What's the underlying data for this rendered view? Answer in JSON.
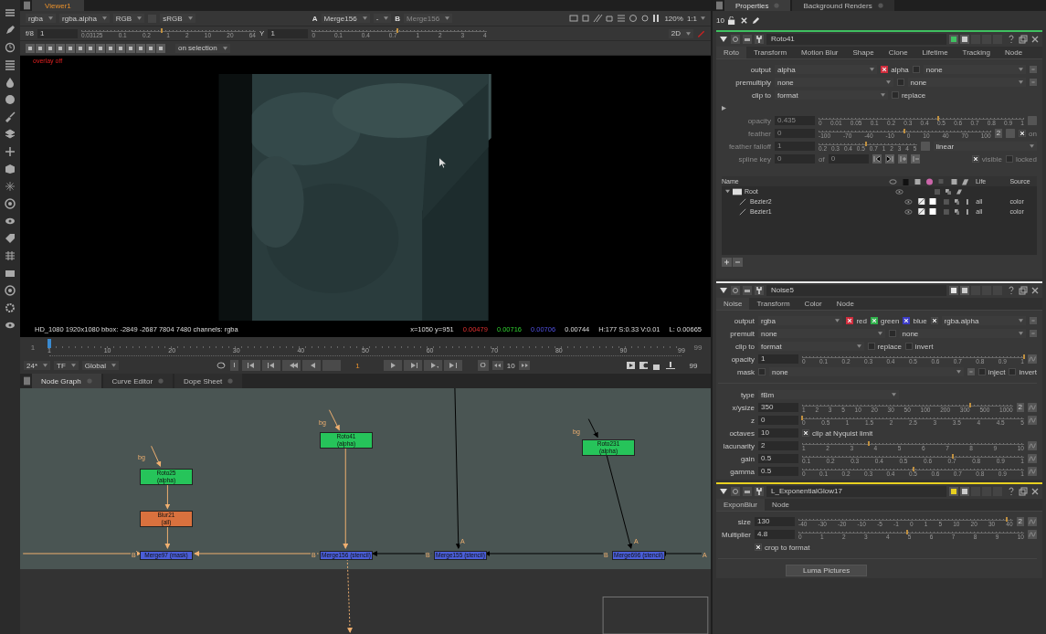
{
  "viewer": {
    "tab": "Viewer1",
    "toolbar": {
      "channels": "rgba",
      "layer": "rgba.alpha",
      "display": "RGB",
      "lut": "sRGB",
      "input_a_label": "A",
      "input_a": "Merge156",
      "operation": "-",
      "input_b_label": "B",
      "input_b": "Merge156",
      "zoom": "120%",
      "proxy": "1:1"
    },
    "gain": {
      "label": "f/8",
      "value": "1",
      "level": 0.46,
      "ticks": [
        "0.03125",
        "0.1",
        "0.2",
        "1",
        "2",
        "10",
        "20",
        "64"
      ]
    },
    "gamma": {
      "label": "Y",
      "value": "1",
      "level": 0.49,
      "ticks": [
        "0",
        "0.1",
        "0.4",
        "0.7",
        "1",
        "2",
        "3",
        "4"
      ]
    },
    "mode": "2D",
    "roi_menu": "on selection",
    "overlay_note": "overlay off",
    "info": {
      "format": "HD_1080 1920x1080  bbox: -2849 -2687 7804 7480 channels: rgba",
      "coords": "x=1050 y=951",
      "r": "0.00479",
      "g": "0.00716",
      "b": "0.00706",
      "a": "0.00744",
      "hsv": "H:177 S:0.33 V:0.01",
      "luma": "L: 0.00665"
    }
  },
  "timeline": {
    "in": "1",
    "out": "99",
    "level": 0,
    "ticks": [
      "1",
      "10",
      "20",
      "30",
      "40",
      "50",
      "60",
      "70",
      "80",
      "90",
      "99"
    ],
    "fps": "24*",
    "tf": "TF",
    "range": "Global",
    "in_mark": "I",
    "frame": "1",
    "out_mark": "O",
    "step": "10",
    "end": "99"
  },
  "node_graph": {
    "tabs": [
      {
        "label": "Node Graph",
        "selected": true
      },
      {
        "label": "Curve Editor",
        "selected": false
      },
      {
        "label": "Dope Sheet",
        "selected": false
      }
    ],
    "nodes": [
      {
        "kind": "roto",
        "name": "Roto25",
        "sub": "(alpha)"
      },
      {
        "kind": "blur",
        "name": "Blur21",
        "sub": "(all)"
      },
      {
        "kind": "merge",
        "name": "Merge97 (mask)"
      },
      {
        "kind": "roto",
        "name": "Roto41",
        "sub": "(alpha)"
      },
      {
        "kind": "merge",
        "name": "Merge156 (stencil)"
      },
      {
        "kind": "merge",
        "name": "Merge155 (stencil)"
      },
      {
        "kind": "roto",
        "name": "Roto231",
        "sub": "(alpha)"
      },
      {
        "kind": "merge",
        "name": "Merge696 (stencil)"
      }
    ],
    "pipe_labels": [
      "bg",
      "bg",
      "bg",
      "B",
      "B",
      "B",
      "B",
      "A",
      "A",
      "A"
    ]
  },
  "properties": {
    "tabs": [
      {
        "label": "Properties",
        "selected": true
      },
      {
        "label": "Background Renders",
        "selected": false
      }
    ],
    "max_panels": "10",
    "panels": [
      {
        "name": "Roto41",
        "color": "#3fc060",
        "tabs": [
          {
            "label": "Roto",
            "selected": true
          },
          {
            "label": "Transform",
            "selected": false
          },
          {
            "label": "Motion Blur",
            "selected": false
          },
          {
            "label": "Shape",
            "selected": false
          },
          {
            "label": "Clone",
            "selected": false
          },
          {
            "label": "Lifetime",
            "selected": false
          },
          {
            "label": "Tracking",
            "selected": false
          },
          {
            "label": "Node",
            "selected": false
          }
        ],
        "rows": [
          {
            "label": "output",
            "disabled": false,
            "widgets": [
              {
                "kind": "menu",
                "value": "alpha"
              },
              {
                "kind": "check",
                "label": "alpha",
                "checked": true,
                "color": "#d02c3c"
              },
              {
                "kind": "check",
                "checked": false
              },
              {
                "kind": "menu",
                "value": "none"
              },
              {
                "kind": "link"
              }
            ]
          },
          {
            "label": "premultiply",
            "disabled": false,
            "widgets": [
              {
                "kind": "menu",
                "value": "none"
              },
              {
                "kind": "check",
                "checked": false
              },
              {
                "kind": "menu",
                "value": "none"
              },
              {
                "kind": "link"
              }
            ]
          },
          {
            "label": "clip to",
            "disabled": false,
            "widgets": [
              {
                "kind": "menu",
                "value": "format"
              },
              {
                "kind": "check",
                "label": "replace",
                "checked": false
              },
              {
                "kind": "spacer"
              }
            ]
          },
          {
            "kind": "expander"
          },
          {
            "label": "opacity",
            "disabled": true,
            "widgets": [
              {
                "kind": "field",
                "value": "0.435"
              },
              {
                "kind": "slider",
                "level": 0.58,
                "ticks": [
                  "0",
                  "0.01",
                  "0.05",
                  "0.1",
                  "0.2",
                  "0.3",
                  "0.4",
                  "0.5",
                  "0.6",
                  "0.7",
                  "0.8",
                  "0.9",
                  "1"
                ]
              },
              {
                "kind": "square"
              }
            ]
          },
          {
            "label": "feather",
            "disabled": true,
            "widgets": [
              {
                "kind": "field",
                "value": "0"
              },
              {
                "kind": "slider",
                "level": 0.5,
                "ticks": [
                  "-100",
                  "-70",
                  "-40",
                  "-10",
                  "0",
                  "10",
                  "40",
                  "70",
                  "100"
                ]
              },
              {
                "kind": "button",
                "label": "2"
              },
              {
                "kind": "square"
              },
              {
                "kind": "check",
                "label": "on",
                "checked": true
              }
            ]
          },
          {
            "label": "feather falloff",
            "disabled": true,
            "widgets": [
              {
                "kind": "field",
                "value": "1"
              },
              {
                "kind": "slider",
                "level": 0.48,
                "ticks": [
                  "0.2",
                  "0.3",
                  "0.4",
                  "0.5",
                  "0.7",
                  "1",
                  "2",
                  "3",
                  "4",
                  "5"
                ]
              },
              {
                "kind": "square"
              },
              {
                "kind": "menu",
                "value": "linear"
              }
            ]
          },
          {
            "label": "spline key",
            "disabled": true,
            "widgets": [
              {
                "kind": "field",
                "value": "0"
              },
              {
                "kind": "text",
                "text": "of"
              },
              {
                "kind": "field",
                "value": "0"
              },
              {
                "kind": "keys"
              },
              {
                "kind": "spacer"
              },
              {
                "kind": "check",
                "label": "visible",
                "checked": true
              },
              {
                "kind": "check",
                "label": "locked",
                "checked": false
              }
            ]
          }
        ],
        "curves": {
          "columns": [
            "Name",
            "Life",
            "Source"
          ],
          "items": [
            {
              "name": "Root",
              "kind": "layer",
              "expanded": true,
              "children": [
                {
                  "name": "Bezier2",
                  "kind": "shape",
                  "life": "all",
                  "source": "color"
                },
                {
                  "name": "Bezier1",
                  "kind": "shape",
                  "life": "all",
                  "source": "color"
                }
              ]
            }
          ]
        }
      },
      {
        "name": "Noise5",
        "color": "#e8e8e8",
        "tabs": [
          {
            "label": "Noise",
            "selected": true
          },
          {
            "label": "Transform",
            "selected": false
          },
          {
            "label": "Color",
            "selected": false
          },
          {
            "label": "Node",
            "selected": false
          }
        ],
        "rows": [
          {
            "label": "output",
            "disabled": false,
            "widgets": [
              {
                "kind": "menu",
                "value": "rgba"
              },
              {
                "kind": "check",
                "label": "red",
                "checked": true,
                "color": "#d02c3c"
              },
              {
                "kind": "check",
                "label": "green",
                "checked": true,
                "color": "#2fb04a"
              },
              {
                "kind": "check",
                "label": "blue",
                "checked": true,
                "color": "#3c3cc8"
              },
              {
                "kind": "check",
                "checked": true
              },
              {
                "kind": "menu",
                "value": "rgba.alpha"
              },
              {
                "kind": "link"
              }
            ]
          },
          {
            "label": "premult",
            "disabled": false,
            "widgets": [
              {
                "kind": "menu",
                "value": "none"
              },
              {
                "kind": "check",
                "checked": false
              },
              {
                "kind": "menu",
                "value": "none"
              },
              {
                "kind": "link"
              }
            ]
          },
          {
            "label": "clip to",
            "disabled": false,
            "widgets": [
              {
                "kind": "menu",
                "value": "format"
              },
              {
                "kind": "check",
                "label": "replace",
                "checked": false
              },
              {
                "kind": "check",
                "label": "invert",
                "checked": false
              },
              {
                "kind": "spacer"
              }
            ]
          },
          {
            "label": "opacity",
            "disabled": false,
            "widgets": [
              {
                "kind": "field",
                "value": "1"
              },
              {
                "kind": "slider",
                "level": 1,
                "ticks": [
                  "0",
                  "0.1",
                  "0.2",
                  "0.3",
                  "0.4",
                  "0.5",
                  "0.6",
                  "0.7",
                  "0.8",
                  "0.9",
                  "1"
                ]
              },
              {
                "kind": "anim"
              }
            ]
          },
          {
            "label": "mask",
            "disabled": false,
            "widgets": [
              {
                "kind": "check",
                "checked": false
              },
              {
                "kind": "menu",
                "value": "none"
              },
              {
                "kind": "link"
              },
              {
                "kind": "check",
                "label": "inject",
                "checked": false
              },
              {
                "kind": "check",
                "label": "invert",
                "checked": false
              }
            ]
          },
          {
            "kind": "divider"
          },
          {
            "label": "type",
            "disabled": false,
            "widgets": [
              {
                "kind": "menu",
                "value": "fBm"
              },
              {
                "kind": "spacer"
              }
            ]
          },
          {
            "label": "x/ysize",
            "disabled": false,
            "widgets": [
              {
                "kind": "field",
                "value": "350"
              },
              {
                "kind": "slider",
                "level": 0.8,
                "ticks": [
                  "1",
                  "2",
                  "3",
                  "5",
                  "10",
                  "20",
                  "30",
                  "50",
                  "100",
                  "200",
                  "300",
                  "500",
                  "1000"
                ]
              },
              {
                "kind": "button",
                "label": "2"
              },
              {
                "kind": "anim"
              }
            ]
          },
          {
            "label": "z",
            "disabled": false,
            "widgets": [
              {
                "kind": "field",
                "value": "0"
              },
              {
                "kind": "slider",
                "level": 0,
                "ticks": [
                  "0",
                  "0.5",
                  "1",
                  "1.5",
                  "2",
                  "2.5",
                  "3",
                  "3.5",
                  "4",
                  "4.5",
                  "5"
                ]
              },
              {
                "kind": "anim"
              }
            ]
          },
          {
            "label": "octaves",
            "disabled": false,
            "widgets": [
              {
                "kind": "field",
                "value": "10"
              },
              {
                "kind": "check",
                "label": "clip at Nyquist limit",
                "checked": true
              },
              {
                "kind": "spacer"
              }
            ]
          },
          {
            "label": "lacunarity",
            "disabled": false,
            "widgets": [
              {
                "kind": "field",
                "value": "2"
              },
              {
                "kind": "slider",
                "level": 0.3,
                "ticks": [
                  "1",
                  "2",
                  "3",
                  "4",
                  "5",
                  "6",
                  "7",
                  "8",
                  "9",
                  "10"
                ]
              },
              {
                "kind": "anim"
              }
            ]
          },
          {
            "label": "gain",
            "disabled": false,
            "widgets": [
              {
                "kind": "field",
                "value": "0.5"
              },
              {
                "kind": "slider",
                "level": 0.68,
                "ticks": [
                  "0.1",
                  "0.2",
                  "0.3",
                  "0.4",
                  "0.5",
                  "0.6",
                  "0.7",
                  "0.8",
                  "0.9",
                  "1"
                ]
              },
              {
                "kind": "anim"
              }
            ]
          },
          {
            "label": "gamma",
            "disabled": false,
            "widgets": [
              {
                "kind": "field",
                "value": "0.5"
              },
              {
                "kind": "slider",
                "level": 0.5,
                "ticks": [
                  "0",
                  "0.1",
                  "0.2",
                  "0.3",
                  "0.4",
                  "0.5",
                  "0.6",
                  "0.7",
                  "0.8",
                  "0.9",
                  "1"
                ]
              },
              {
                "kind": "anim"
              }
            ]
          }
        ]
      },
      {
        "name": "L_ExponentialGlow17",
        "color": "#e8d020",
        "tabs": [
          {
            "label": "ExponBlur",
            "selected": true
          },
          {
            "label": "Node",
            "selected": false
          }
        ],
        "rows": [
          {
            "label": "size",
            "disabled": false,
            "widgets": [
              {
                "kind": "field",
                "value": "130"
              },
              {
                "kind": "slider",
                "level": 0.97,
                "ticks": [
                  "-40",
                  "-30",
                  "-20",
                  "-10",
                  "-5",
                  "-1",
                  "0",
                  "1",
                  "5",
                  "10",
                  "20",
                  "30",
                  "40"
                ]
              },
              {
                "kind": "button",
                "label": "2"
              },
              {
                "kind": "anim"
              }
            ]
          },
          {
            "label": "Multiplier",
            "disabled": false,
            "widgets": [
              {
                "kind": "field",
                "value": "4.8"
              },
              {
                "kind": "slider",
                "level": 0.48,
                "ticks": [
                  "0",
                  "1",
                  "2",
                  "3",
                  "4",
                  "5",
                  "6",
                  "7",
                  "8",
                  "9",
                  "10"
                ]
              },
              {
                "kind": "anim"
              }
            ]
          },
          {
            "label": "",
            "disabled": false,
            "widgets": [
              {
                "kind": "check",
                "label": "crop to format",
                "checked": true
              },
              {
                "kind": "spacer"
              }
            ]
          },
          {
            "kind": "divider"
          },
          {
            "label": "",
            "disabled": false,
            "widgets": [
              {
                "kind": "action",
                "label": "Luma Pictures"
              },
              {
                "kind": "spacer"
              }
            ]
          }
        ]
      }
    ]
  }
}
